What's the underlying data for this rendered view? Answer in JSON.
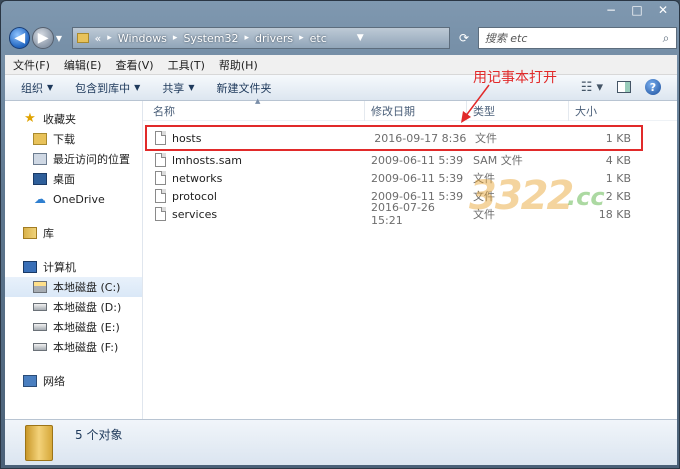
{
  "window": {
    "controls": {
      "minimize": "−",
      "maximize": "□",
      "close": "✕"
    }
  },
  "address": {
    "prefix": "«",
    "crumbs": [
      "Windows",
      "System32",
      "drivers",
      "etc"
    ]
  },
  "search": {
    "placeholder": "搜索 etc"
  },
  "menu": {
    "items": [
      "文件(F)",
      "编辑(E)",
      "查看(V)",
      "工具(T)",
      "帮助(H)"
    ]
  },
  "commands": {
    "items": [
      "组织",
      "包含到库中",
      "共享",
      "新建文件夹"
    ]
  },
  "annotation": {
    "text": "用记事本打开",
    "color": "#e12a2a"
  },
  "nav": {
    "favorites": "收藏夹",
    "downloads": "下载",
    "recent": "最近访问的位置",
    "desktop": "桌面",
    "onedrive": "OneDrive",
    "libraries": "库",
    "computer": "计算机",
    "drives": [
      "本地磁盘 (C:)",
      "本地磁盘 (D:)",
      "本地磁盘 (E:)",
      "本地磁盘 (F:)"
    ],
    "network": "网络"
  },
  "columns": {
    "name": "名称",
    "date": "修改日期",
    "type": "类型",
    "size": "大小"
  },
  "files": [
    {
      "name": "hosts",
      "date": "2016-09-17 8:36",
      "type": "文件",
      "size": "1 KB"
    },
    {
      "name": "lmhosts.sam",
      "date": "2009-06-11 5:39",
      "type": "SAM 文件",
      "size": "4 KB"
    },
    {
      "name": "networks",
      "date": "2009-06-11 5:39",
      "type": "文件",
      "size": "1 KB"
    },
    {
      "name": "protocol",
      "date": "2009-06-11 5:39",
      "type": "文件",
      "size": "2 KB"
    },
    {
      "name": "services",
      "date": "2016-07-26 15:21",
      "type": "文件",
      "size": "18 KB"
    }
  ],
  "watermark": {
    "main": "3322",
    "sub": ".cc"
  },
  "status": {
    "text": "5 个对象"
  }
}
